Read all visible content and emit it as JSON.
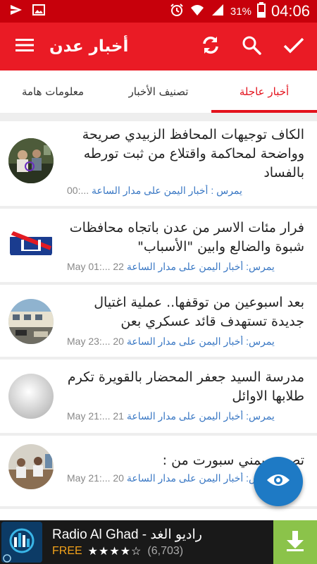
{
  "status_bar": {
    "battery_percent": "31%",
    "time": "04:06"
  },
  "app_bar": {
    "title": "أخبار عدن",
    "accent": "#ea1b25"
  },
  "tabs": [
    {
      "label": "معلومات هامة",
      "active": false
    },
    {
      "label": "تصنيف الأخبار",
      "active": false
    },
    {
      "label": "أخبار عاجلة",
      "active": true
    }
  ],
  "news": [
    {
      "headline": "الكاف توجيهات المحافظ الزبيدي صريحة وواضحة لمحاكمة واقتلاع من ثبت تورطه بالفساد",
      "date": "00:...",
      "source": "يمرس : أخبار اليمن على مدار الساعة",
      "thumb_icon": "group-photo"
    },
    {
      "headline": "فرار مئات الاسر من عدن باتجاه محافظات شبوة والضالع وابين \"الأسباب\"",
      "date": "May 01:... 22",
      "source": "يمرس: أخبار اليمن على مدار الساعة",
      "thumb_icon": "flag-logo"
    },
    {
      "headline": "بعد اسبوعين من توقفها.. عملية اغتيال جديدة تستهدف قائد عسكري بعن",
      "date": "May 23:... 20",
      "source": "يمرس: أخبار اليمن على مدار الساعة",
      "thumb_icon": "street-photo"
    },
    {
      "headline": "مدرسة السيد جعفر المحضار بالقويرة تكرم طلابها الاوائل",
      "date": "May 21:... 21",
      "source": "يمرس: أخبار اليمن على مدار الساعة",
      "thumb_icon": "blurred-photo"
    },
    {
      "headline": "تصريح يمني سبورت من :",
      "date": "May 21:... 20",
      "source": "يمرس: أخبار اليمن على مدار الساعة",
      "thumb_icon": "meeting-photo"
    }
  ],
  "ad": {
    "title": "Radio Al Ghad - راديو الغد",
    "price": "FREE",
    "stars": "★★★★☆",
    "reviews": "(6,703)"
  }
}
